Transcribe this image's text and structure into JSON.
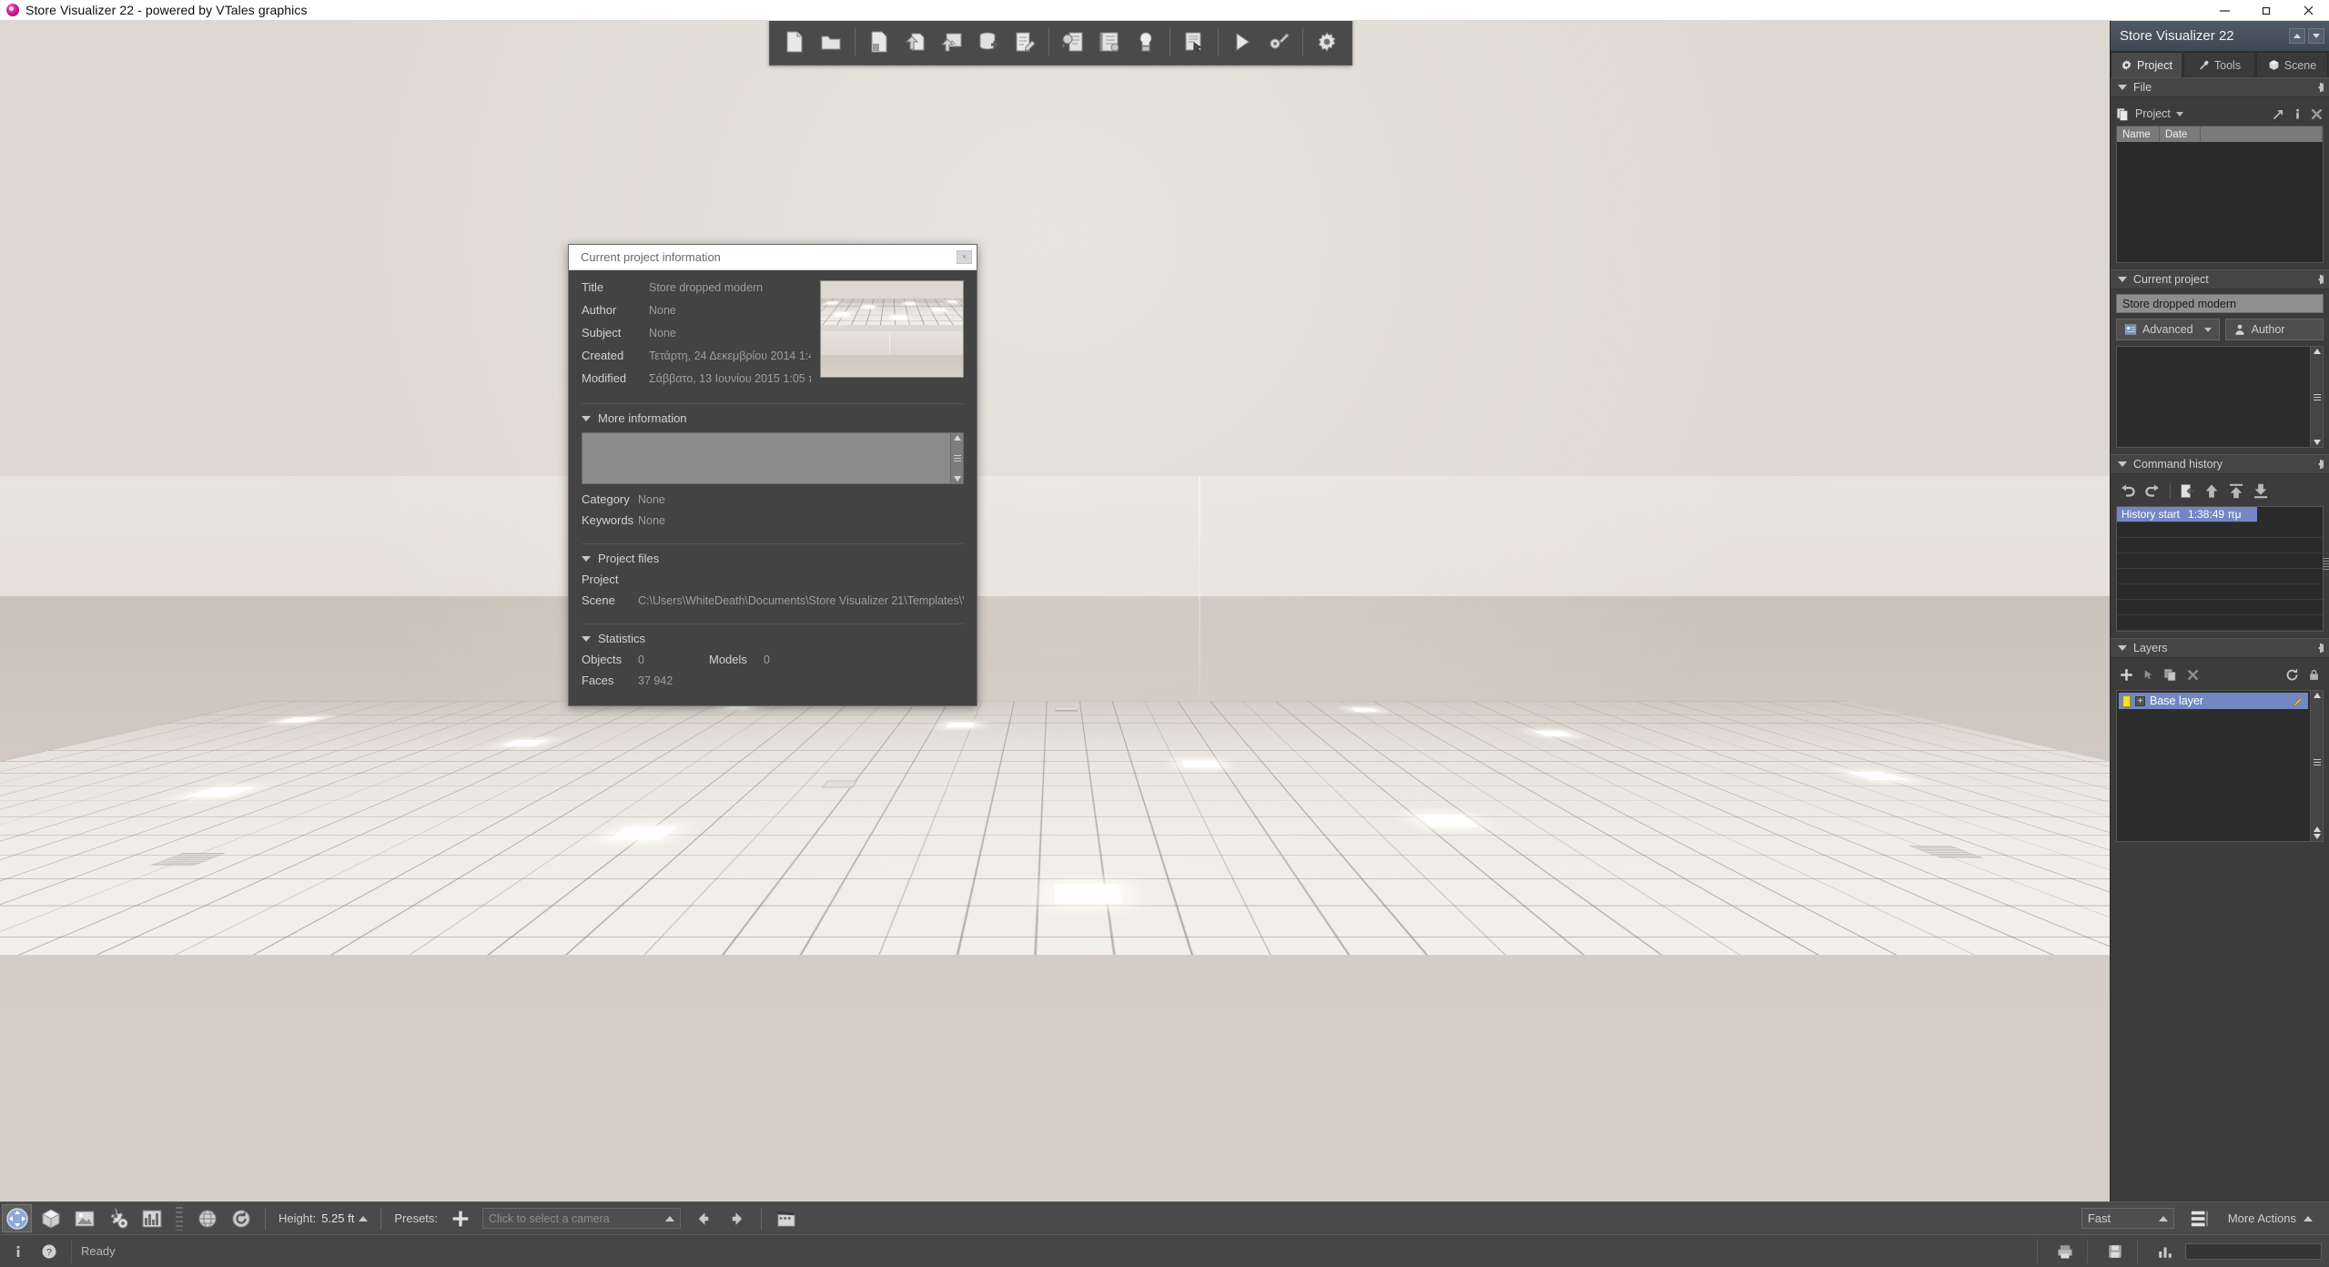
{
  "window": {
    "title": "Store Visualizer 22 - powered by VTales graphics",
    "app_icon": "app-logo-icon",
    "controls": {
      "minimize": "minimize-icon",
      "maximize": "maximize-icon",
      "close": "close-icon"
    }
  },
  "toolbar": {
    "items": [
      {
        "name": "new-project-button",
        "icon": "document-new-icon"
      },
      {
        "name": "open-project-button",
        "icon": "folder-open-icon"
      },
      {
        "name": "save-project-button",
        "icon": "document-save-icon"
      },
      {
        "name": "import-model-button",
        "icon": "import-arrow-up-icon"
      },
      {
        "name": "import-image-button",
        "icon": "image-import-icon"
      },
      {
        "name": "add-database-button",
        "icon": "database-add-icon"
      },
      {
        "name": "edit-notes-button",
        "icon": "document-edit-icon"
      },
      {
        "name": "search-catalog-button",
        "icon": "catalog-search-icon"
      },
      {
        "name": "library-button",
        "icon": "library-book-icon"
      },
      {
        "name": "lighting-button",
        "icon": "light-bulb-icon"
      },
      {
        "name": "report-button",
        "icon": "report-cursor-icon"
      },
      {
        "name": "play-presentation-button",
        "icon": "play-triangle-icon"
      },
      {
        "name": "tools-options-button",
        "icon": "gear-wrench-icon"
      },
      {
        "name": "settings-button",
        "icon": "gear-icon"
      }
    ]
  },
  "dialog": {
    "title": "Current project information",
    "close_label": "×",
    "fields": [
      {
        "label": "Title",
        "value": "Store dropped modern"
      },
      {
        "label": "Author",
        "value": "None"
      },
      {
        "label": "Subject",
        "value": "None"
      },
      {
        "label": "Created",
        "value": "Τετάρτη, 24 Δεκεμβρίου 2014 1:4"
      },
      {
        "label": "Modified",
        "value": "Σάββατο, 13 Ιουνίου 2015 1:05 π"
      }
    ],
    "thumbnail_name": "project-thumbnail",
    "more_information": {
      "heading": "More information",
      "notes_value": "",
      "category_label": "Category",
      "category_value": "None",
      "keywords_label": "Keywords",
      "keywords_value": "None"
    },
    "project_files": {
      "heading": "Project files",
      "project_label": "Project",
      "project_value": "",
      "scene_label": "Scene",
      "scene_value": "C:\\Users\\WhiteDeath\\Documents\\Store Visualizer 21\\Templates\\V"
    },
    "statistics": {
      "heading": "Statistics",
      "objects_label": "Objects",
      "objects_value": "0",
      "models_label": "Models",
      "models_value": "0",
      "faces_label": "Faces",
      "faces_value": "37 942"
    }
  },
  "sidebar": {
    "title": "Store Visualizer 22",
    "tabs": [
      {
        "label": "Project",
        "icon": "gear-icon",
        "active": true
      },
      {
        "label": "Tools",
        "icon": "wrench-icon",
        "active": false
      },
      {
        "label": "Scene",
        "icon": "cube-icon",
        "active": false
      }
    ],
    "file_panel": {
      "heading": "File",
      "source_label": "Project",
      "source_icon": "copy-pages-icon",
      "actions": [
        {
          "name": "open-external-button",
          "icon": "arrow-out-icon"
        },
        {
          "name": "info-button",
          "icon": "info-icon"
        },
        {
          "name": "delete-button",
          "icon": "delete-x-icon"
        }
      ],
      "columns": [
        "Name",
        "Date"
      ]
    },
    "current_project_panel": {
      "heading": "Current project",
      "project_name": "Store dropped modern",
      "advanced_button": "Advanced",
      "advanced_icon": "properties-icon",
      "author_button": "Author",
      "author_icon": "user-icon"
    },
    "command_history_panel": {
      "heading": "Command history",
      "tools": [
        {
          "name": "undo-button",
          "icon": "undo-arrow-icon"
        },
        {
          "name": "redo-button",
          "icon": "redo-arrow-icon"
        },
        {
          "name": "revert-to-state-button",
          "icon": "revert-document-icon"
        },
        {
          "name": "move-up-button",
          "icon": "arrow-up-icon"
        },
        {
          "name": "move-to-top-button",
          "icon": "arrow-to-top-icon"
        },
        {
          "name": "move-to-bottom-button",
          "icon": "arrow-to-bottom-icon"
        }
      ],
      "entries": [
        {
          "label": "History start",
          "time": "1:38:49 πμ",
          "selected": true
        }
      ]
    },
    "layers_panel": {
      "heading": "Layers",
      "tools": [
        {
          "name": "add-layer-button",
          "icon": "plus-icon"
        },
        {
          "name": "select-layer-button",
          "icon": "cursor-arrow-icon"
        },
        {
          "name": "duplicate-layer-button",
          "icon": "duplicate-icon"
        },
        {
          "name": "delete-layer-button",
          "icon": "delete-x-icon"
        },
        {
          "name": "refresh-layers-button",
          "icon": "refresh-icon"
        },
        {
          "name": "lock-layer-button",
          "icon": "lock-icon"
        }
      ],
      "layers": [
        {
          "name": "Base layer",
          "color": "#f5e02a",
          "selected": true,
          "edit_icon": "pencil-icon"
        }
      ]
    }
  },
  "bottombar": {
    "view_modes": [
      {
        "name": "navigate-mode-button",
        "icon": "pan-navigate-icon",
        "active": true
      },
      {
        "name": "object-mode-button",
        "icon": "cube-icon",
        "active": false
      },
      {
        "name": "image-mode-button",
        "icon": "image-icon",
        "active": false
      },
      {
        "name": "settings-mode-button",
        "icon": "gears-icon",
        "active": false
      },
      {
        "name": "statistics-mode-button",
        "icon": "bar-chart-icon",
        "active": false
      }
    ],
    "camera_tools": [
      {
        "name": "globe-view-button",
        "icon": "globe-icon"
      },
      {
        "name": "reset-view-button",
        "icon": "refresh-circle-icon"
      }
    ],
    "height_label": "Height:",
    "height_value": "5.25 ft",
    "presets_label": "Presets:",
    "add_preset_icon": "plus-icon",
    "camera_placeholder": "Click to select a camera",
    "prev_camera_icon": "arrow-left-icon",
    "next_camera_icon": "arrow-right-icon",
    "movie_icon": "clapperboard-icon",
    "speed_value": "Fast",
    "list_icon": "list-lines-icon",
    "more_actions_label": "More Actions"
  },
  "statusbar": {
    "info_icon": "info-icon",
    "help_icon": "help-question-icon",
    "status_text": "Ready",
    "right_icons": [
      {
        "name": "render-status-icon",
        "icon": "printer-icon"
      },
      {
        "name": "save-status-icon",
        "icon": "floppy-icon"
      },
      {
        "name": "performance-icon",
        "icon": "bar-chart-icon"
      }
    ]
  },
  "viewport": {
    "name": "3d-viewport",
    "scene_description": "Empty retail room with dropped ceiling grid and recessed lights",
    "colors": {
      "wall": "#e2ddd6",
      "floor": "#d2ccc4",
      "ceiling": "#efece7"
    }
  }
}
